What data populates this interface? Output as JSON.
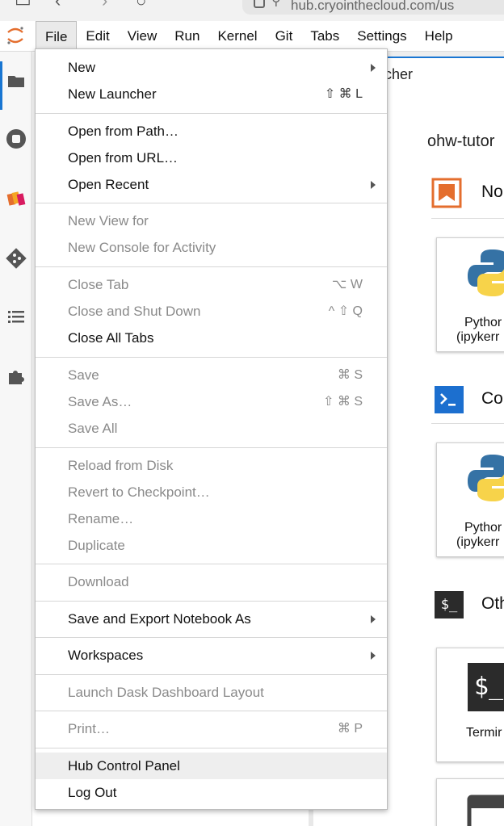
{
  "browser": {
    "url": "hub.cryointhecloud.com/us",
    "back_icon": "arrow-left-icon",
    "forward_icon": "arrow-right-icon",
    "reload_icon": "reload-icon"
  },
  "menubar": {
    "logo": "jupyter-logo",
    "items": [
      "File",
      "Edit",
      "View",
      "Run",
      "Kernel",
      "Git",
      "Tabs",
      "Settings",
      "Help"
    ],
    "active": "File"
  },
  "sidebar": {
    "icons": [
      "folder-icon",
      "stop-circle-icon",
      "layers-icon",
      "git-icon",
      "list-icon",
      "puzzle-icon"
    ]
  },
  "file_menu": {
    "groups": [
      [
        {
          "label": "New",
          "submenu": true,
          "enabled": true
        },
        {
          "label": "New Launcher",
          "shortcut": "⇧ ⌘ L",
          "enabled": true
        }
      ],
      [
        {
          "label": "Open from Path…",
          "enabled": true
        },
        {
          "label": "Open from URL…",
          "enabled": true
        },
        {
          "label": "Open Recent",
          "submenu": true,
          "enabled": true
        }
      ],
      [
        {
          "label": "New View for",
          "enabled": false
        },
        {
          "label": "New Console for Activity",
          "enabled": false
        }
      ],
      [
        {
          "label": "Close Tab",
          "shortcut": "⌥ W",
          "enabled": false
        },
        {
          "label": "Close and Shut Down",
          "shortcut": "^ ⇧ Q",
          "enabled": false
        },
        {
          "label": "Close All Tabs",
          "enabled": true
        }
      ],
      [
        {
          "label": "Save",
          "shortcut": "⌘ S",
          "enabled": false
        },
        {
          "label": "Save As…",
          "shortcut": "⇧ ⌘ S",
          "enabled": false
        },
        {
          "label": "Save All",
          "enabled": false
        }
      ],
      [
        {
          "label": "Reload from Disk",
          "enabled": false
        },
        {
          "label": "Revert to Checkpoint…",
          "enabled": false
        },
        {
          "label": "Rename…",
          "enabled": false
        },
        {
          "label": "Duplicate",
          "enabled": false
        }
      ],
      [
        {
          "label": "Download",
          "enabled": false
        }
      ],
      [
        {
          "label": "Save and Export Notebook As",
          "submenu": true,
          "enabled": true
        }
      ],
      [
        {
          "label": "Workspaces",
          "submenu": true,
          "enabled": true
        }
      ],
      [
        {
          "label": "Launch Dask Dashboard Layout",
          "enabled": false
        }
      ],
      [
        {
          "label": "Print…",
          "shortcut": "⌘ P",
          "enabled": false
        }
      ],
      [
        {
          "label": "Hub Control Panel",
          "enabled": true,
          "highlighted": true
        },
        {
          "label": "Log Out",
          "enabled": true
        }
      ]
    ]
  },
  "launcher": {
    "tab_label": "cher",
    "cwd": "ohw-tutor",
    "sections": [
      {
        "title": "No",
        "icon": "notebook-icon",
        "cards": [
          {
            "line1": "Pythor",
            "line2": "(ipykerr",
            "icon": "python-logo"
          }
        ]
      },
      {
        "title": "Co",
        "icon": "console-icon",
        "cards": [
          {
            "line1": "Pythor",
            "line2": "(ipykerr",
            "icon": "python-logo"
          }
        ]
      },
      {
        "title": "Oth",
        "icon": "other-icon",
        "cards": [
          {
            "line1": "Termir",
            "line2": "",
            "icon": "terminal-icon"
          }
        ]
      }
    ],
    "terminal_glyph": "$_",
    "console_glyph": ">_",
    "other_glyph": "$_"
  },
  "colors": {
    "accent_blue": "#1976d2",
    "notebook_orange": "#e46e2e",
    "console_blue": "#1c6fcf",
    "python_blue": "#3572a5",
    "python_yellow": "#f7d34a"
  }
}
